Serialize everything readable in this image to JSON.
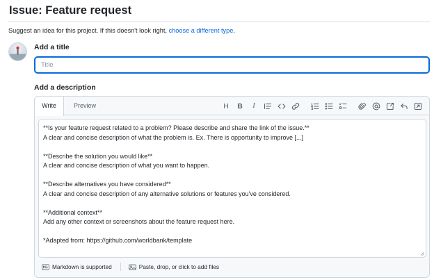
{
  "page": {
    "title": "Issue: Feature request",
    "suggest_text": "Suggest an idea for this project. If this doesn't look right, ",
    "suggest_link": "choose a different type",
    "suggest_end": "."
  },
  "title_section": {
    "label": "Add a title",
    "placeholder": "Title",
    "value": ""
  },
  "description_section": {
    "label": "Add a description",
    "tabs": [
      {
        "label": "Write",
        "active": true
      },
      {
        "label": "Preview",
        "active": false
      }
    ],
    "toolbar_icons": [
      "heading-icon",
      "bold-icon",
      "italic-icon",
      "quote-icon",
      "code-icon",
      "link-icon",
      "numbered-list-icon",
      "unordered-list-icon",
      "task-list-icon",
      "attach-icon",
      "mention-icon",
      "reference-icon",
      "undo-icon",
      "fullscreen-icon"
    ],
    "toolbar_text": {
      "heading": "H",
      "bold": "B",
      "italic": "I"
    },
    "body_lines": [
      "**Is your feature request related to a problem? Please describe and share the link of the issue.**",
      "A clear and concise description of what the problem is. Ex. There is opportunity to improve [...]",
      "",
      "**Describe the solution you would like**",
      "A clear and concise description of what you want to happen.",
      "",
      "**Describe alternatives you have considered**",
      "A clear and concise description of any alternative solutions or features you've considered.",
      "",
      "**Additional context**",
      "Add any other context or screenshots about the feature request here.",
      "",
      "*Adapted from: https://github.com/worldbank/template"
    ]
  },
  "footer": {
    "markdown_label": "Markdown is supported",
    "paste_label": "Paste, drop, or click to add files"
  },
  "colors": {
    "link": "#0969da",
    "focus_border": "#0969da",
    "border": "#d0d7de",
    "muted_text": "#59636e"
  }
}
